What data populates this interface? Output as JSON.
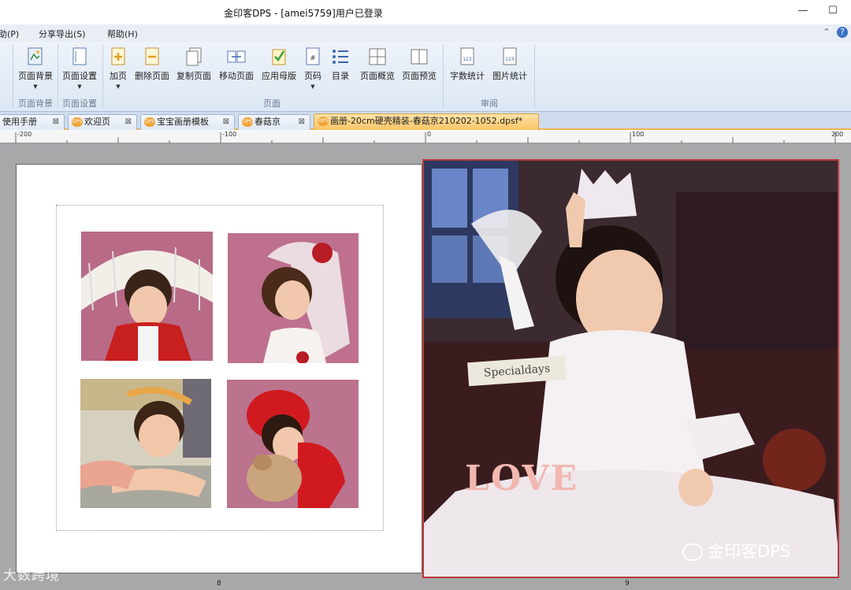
{
  "window": {
    "title": "金印客DPS - [amei5759]用户已登录",
    "minimize": "—",
    "maximize": "☐"
  },
  "menu": {
    "items": [
      "助(P)",
      "分享导出(S)",
      "帮助(H)"
    ]
  },
  "ribbon": {
    "buttons": [
      {
        "label": "页面背景",
        "icon": "page-background-icon"
      },
      {
        "label": "页面设置",
        "icon": "page-setup-icon"
      },
      {
        "label": "加页",
        "icon": "add-page-icon"
      },
      {
        "label": "删除页面",
        "icon": "delete-page-icon"
      },
      {
        "label": "复制页面",
        "icon": "copy-page-icon"
      },
      {
        "label": "移动页面",
        "icon": "move-page-icon"
      },
      {
        "label": "应用母版",
        "icon": "apply-master-icon"
      },
      {
        "label": "页码",
        "icon": "page-number-icon"
      },
      {
        "label": "目录",
        "icon": "toc-icon"
      },
      {
        "label": "页面概览",
        "icon": "page-overview-icon"
      },
      {
        "label": "页面预览",
        "icon": "page-preview-icon"
      },
      {
        "label": "字数统计",
        "icon": "word-count-icon"
      },
      {
        "label": "图片统计",
        "icon": "image-count-icon"
      }
    ],
    "groups": [
      "页面背景",
      "页面设置",
      "页面",
      "审阅"
    ]
  },
  "tabs": [
    {
      "label": "使用手册"
    },
    {
      "label": "欢迎页"
    },
    {
      "label": "宝宝画册模板"
    },
    {
      "label": "春菇京"
    },
    {
      "label": "画册-20cm硬壳精装-春菇京210202-1052.dpsf*",
      "active": true
    }
  ],
  "ruler": {
    "labels": [
      "-200",
      "-100",
      "0",
      "100",
      "200"
    ]
  },
  "page": {
    "left_number": "8",
    "right_number": "9",
    "sticker_text": "Specialdays",
    "love_text": "LOVE"
  },
  "watermarks": {
    "bottom_left": "大数跨境",
    "bottom_right": "金印客DPS"
  },
  "colors": {
    "ribbon": "#dde7f4",
    "active_tab": "#f9c465",
    "canvas": "#a8a8ab",
    "page_border": "#b83a3a"
  }
}
